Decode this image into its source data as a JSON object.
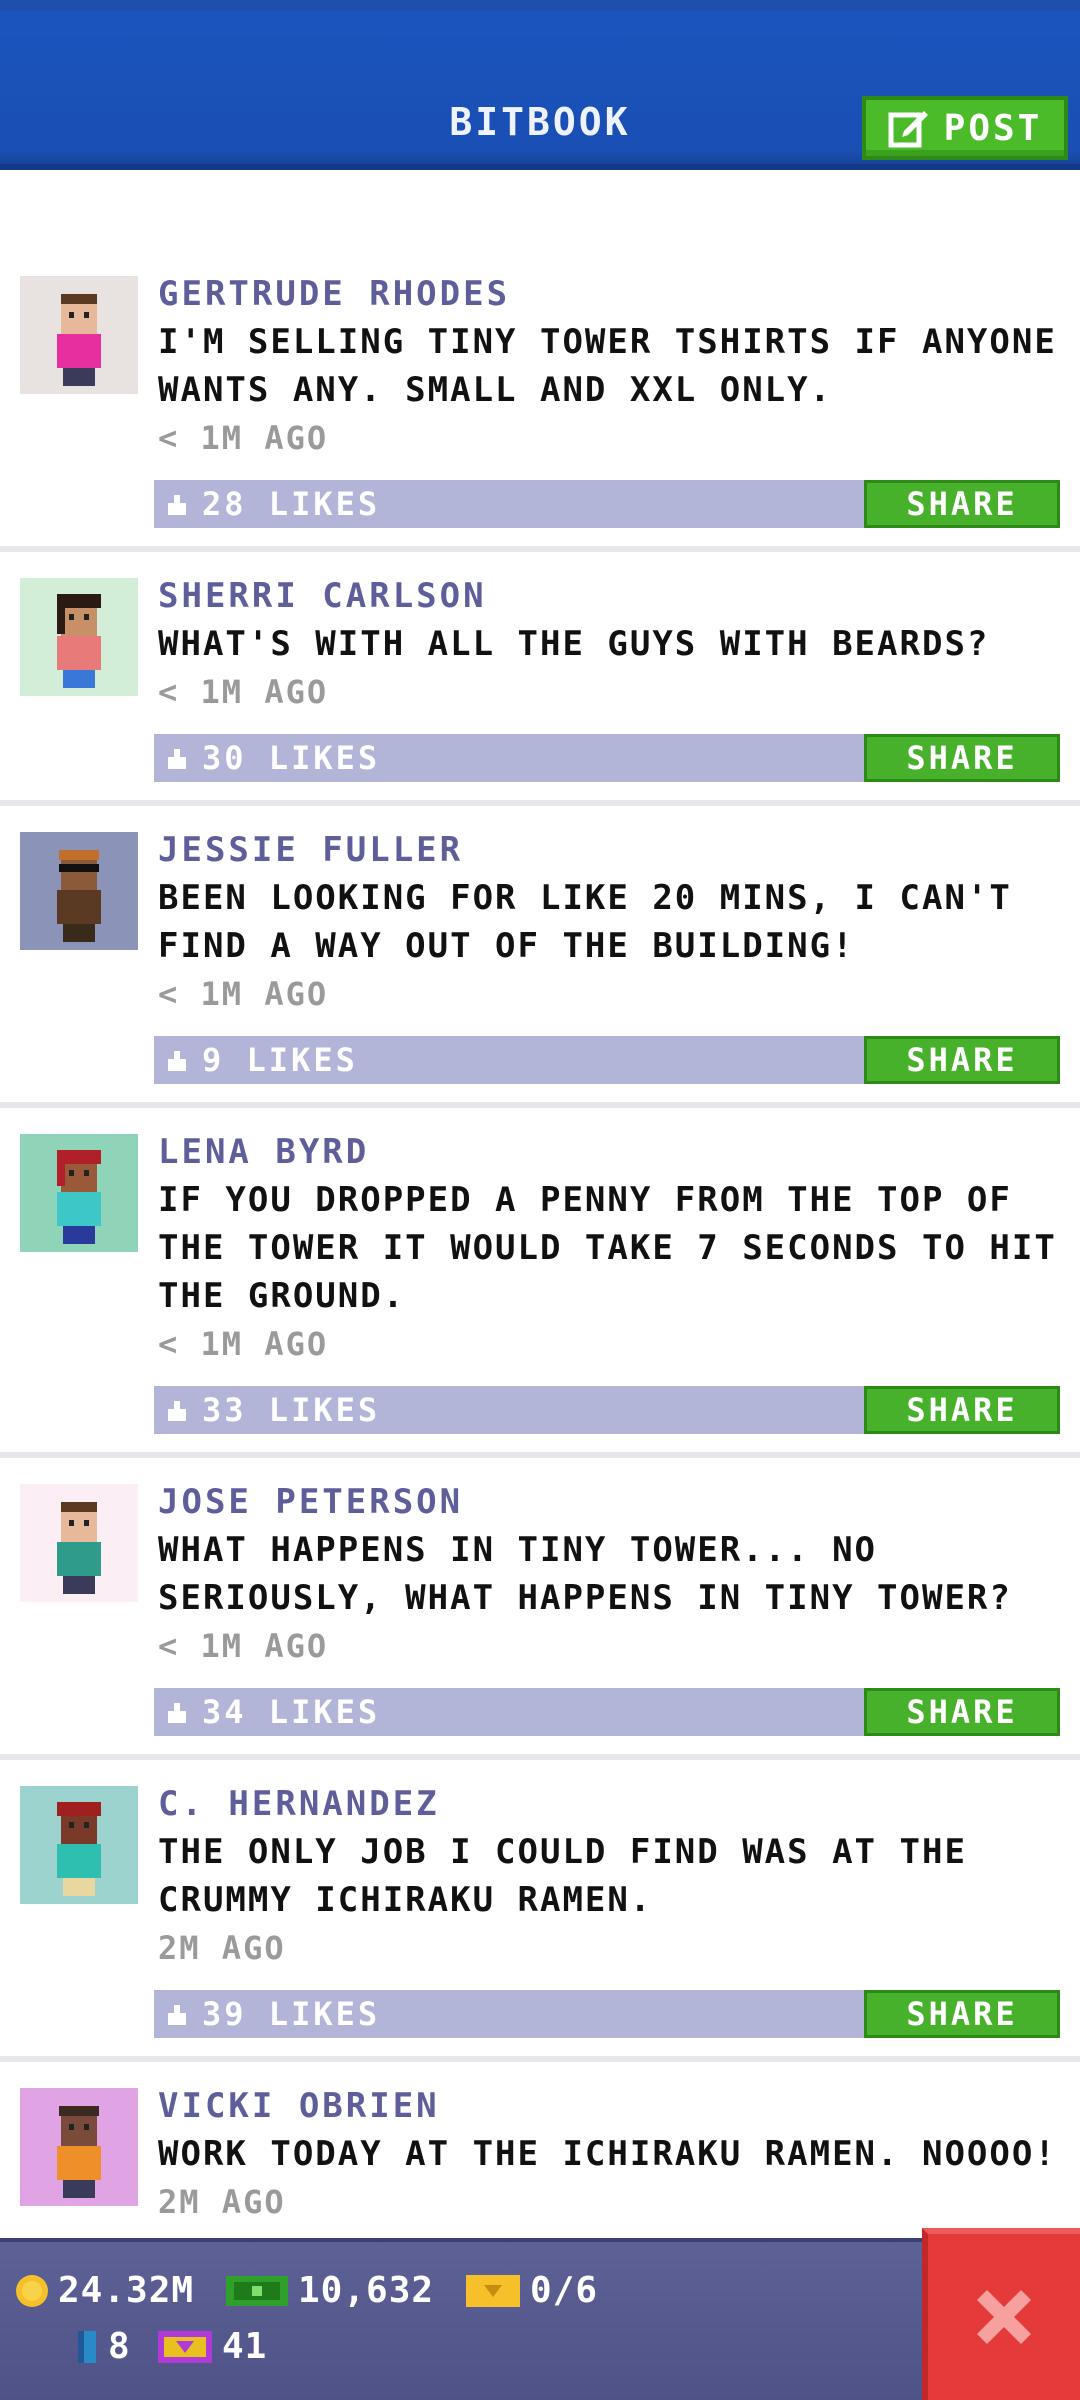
{
  "header": {
    "title": "BITBOOK",
    "post_label": "POST"
  },
  "posts": [
    {
      "author": "GERTRUDE RHODES",
      "message": "I'M SELLING TINY TOWER TSHIRTS IF ANYONE WANTS ANY. SMALL AND XXL ONLY.",
      "time": "< 1M AGO",
      "likes": "28 LIKES",
      "share": "SHARE",
      "avatar_bg": "#e8e2e0",
      "shirt_color": "#e82f9f"
    },
    {
      "author": "SHERRI CARLSON",
      "message": "WHAT'S WITH ALL THE GUYS WITH BEARDS?",
      "time": "< 1M AGO",
      "likes": "30 LIKES",
      "share": "SHARE",
      "avatar_bg": "#d3eed8",
      "shirt_color": "#e87a7a"
    },
    {
      "author": "JESSIE FULLER",
      "message": "BEEN LOOKING FOR LIKE 20 MINS, I CAN'T FIND A WAY OUT OF THE BUILDING!",
      "time": "< 1M AGO",
      "likes": "9 LIKES",
      "share": "SHARE",
      "avatar_bg": "#8b93b8",
      "shirt_color": "#5a3a22"
    },
    {
      "author": "LENA BYRD",
      "message": "IF YOU DROPPED A PENNY FROM THE TOP OF THE TOWER IT WOULD TAKE 7 SECONDS TO HIT THE GROUND.",
      "time": "< 1M AGO",
      "likes": "33 LIKES",
      "share": "SHARE",
      "avatar_bg": "#8fd3b9",
      "shirt_color": "#3ec7c7"
    },
    {
      "author": "JOSE PETERSON",
      "message": "WHAT HAPPENS IN TINY TOWER... NO SERIOUSLY, WHAT HAPPENS IN TINY TOWER?",
      "time": "< 1M AGO",
      "likes": "34 LIKES",
      "share": "SHARE",
      "avatar_bg": "#fbeef4",
      "shirt_color": "#2f9b8b"
    },
    {
      "author": "C. HERNANDEZ",
      "message": "THE ONLY JOB I COULD FIND WAS AT THE CRUMMY ICHIRAKU RAMEN.",
      "time": "2M AGO",
      "likes": "39 LIKES",
      "share": "SHARE",
      "avatar_bg": "#9dd3cf",
      "shirt_color": "#2fbfb0"
    },
    {
      "author": "VICKI OBRIEN",
      "message": "WORK TODAY AT THE ICHIRAKU RAMEN. NOOOO!",
      "time": "2M AGO",
      "likes": "",
      "share": "",
      "avatar_bg": "#e0a3e3",
      "shirt_color": "#ef8f2a"
    }
  ],
  "status": {
    "coins": "24.32M",
    "bux": "10,632",
    "tickets": "0/6",
    "floors": "8",
    "vip": "41"
  }
}
